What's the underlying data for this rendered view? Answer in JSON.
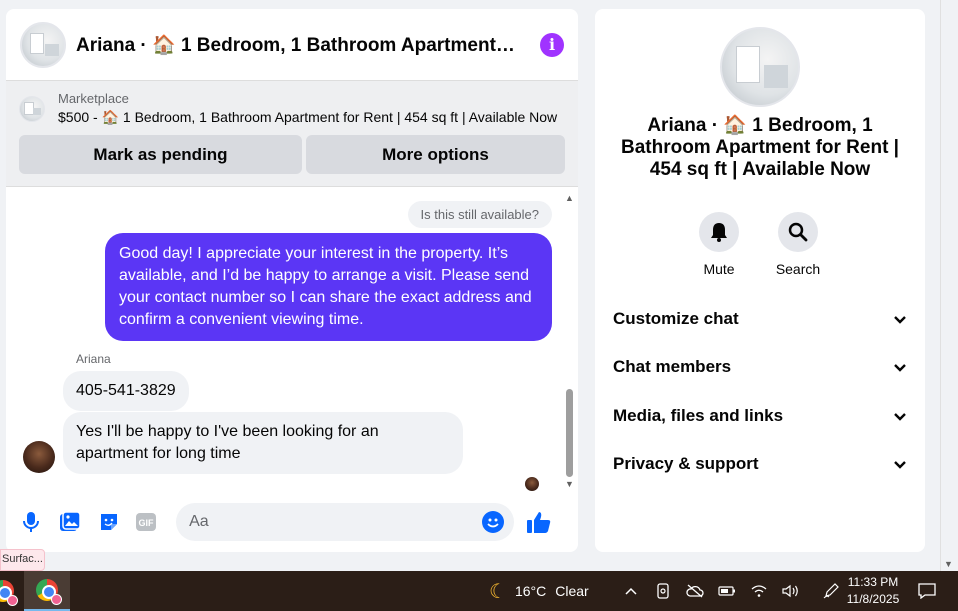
{
  "chat": {
    "title": "Ariana · 🏠 1 Bedroom, 1 Bathroom Apartment for Rent | 454 sq ft | Available Now",
    "listing": {
      "label": "Marketplace",
      "title": "$500 - 🏠 1 Bedroom, 1 Bathroom Apartment for Rent | 454 sq ft | Available Now",
      "mark_pending": "Mark as pending",
      "more_options": "More options"
    },
    "messages": {
      "quoted": "Is this still available?",
      "outgoing": "Good day! I appreciate your interest in the property. It’s available, and I’d be happy to arrange a visit. Please send your contact number so I can share the exact address and confirm a convenient viewing time.",
      "sender_name": "Ariana",
      "incoming_1": "405-541-3829",
      "incoming_2": "Yes I'll be happy to I've been looking for an apartment for long time"
    },
    "composer": {
      "placeholder": "Aa"
    }
  },
  "tooltip": "Surfac...",
  "side": {
    "title": "Ariana · 🏠 1 Bedroom, 1 Bathroom Apartment for Rent | 454 sq ft | Available Now",
    "actions": {
      "mute": "Mute",
      "search": "Search"
    },
    "menu": {
      "customize": "Customize chat",
      "members": "Chat members",
      "media": "Media, files and links",
      "privacy": "Privacy & support"
    }
  },
  "taskbar": {
    "weather_temp": "16°C",
    "weather_desc": "Clear",
    "time": "11:33 PM",
    "date": "11/8/2025"
  },
  "colors": {
    "accent": "#0866ff",
    "outgoing_bubble": "#5b36f5",
    "info_icon": "#a033ff",
    "taskbar": "#2b1e17"
  }
}
